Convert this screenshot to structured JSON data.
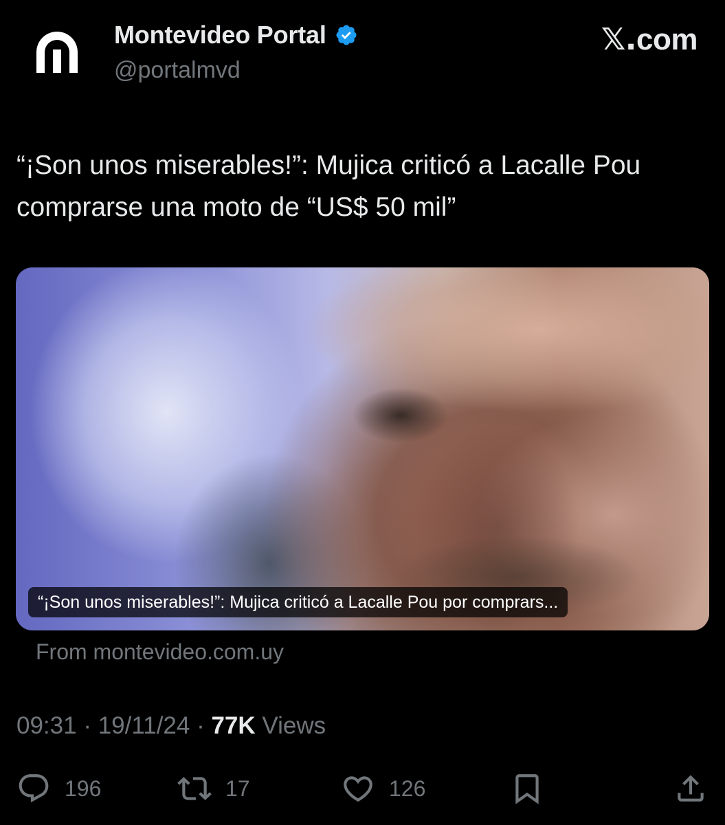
{
  "author": {
    "display_name": "Montevideo Portal",
    "handle": "@portalmvd",
    "verified": true,
    "avatar_icon": "montevideo-portal-logo-icon"
  },
  "brand": {
    "label": "com",
    "prefix": "𝕏."
  },
  "tweet": {
    "text": "“¡Son unos miserables!”: Mujica criticó a Lacalle Pou comprarse una moto de “US$ 50 mil”"
  },
  "link_card": {
    "caption": "“¡Son unos miserables!”: Mujica criticó a Lacalle Pou por comprars...",
    "source": "From montevideo.com.uy"
  },
  "meta": {
    "time": "09:31",
    "separator": " · ",
    "date": "19/11/24",
    "views_count": "77K",
    "views_label": " Views"
  },
  "actions": {
    "replies": "196",
    "reposts": "17",
    "likes": "126"
  },
  "colors": {
    "background": "#000000",
    "primary_text": "#e7e9ea",
    "secondary_text": "#71767b",
    "verified_blue": "#1d9bf0"
  }
}
